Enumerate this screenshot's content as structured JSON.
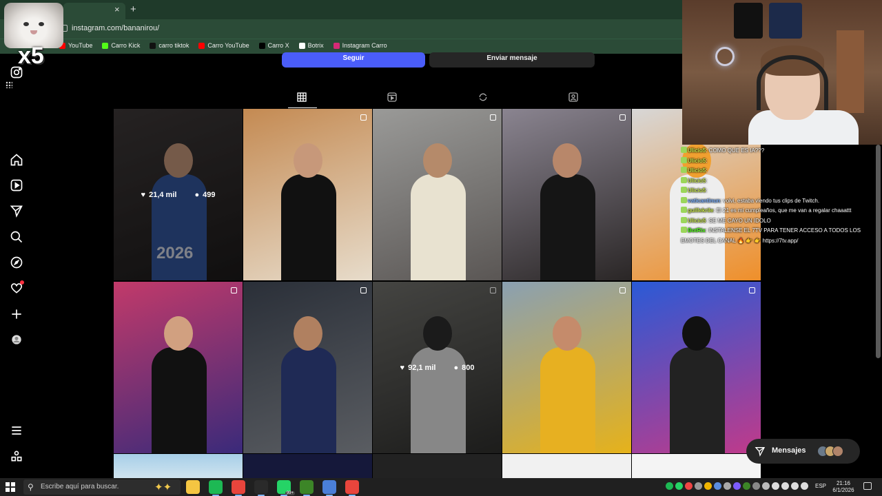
{
  "browser": {
    "url": "instagram.com/bananirou/",
    "tab_close_glyph": "×",
    "new_tab_glyph": "+",
    "bookmarks": [
      {
        "label": "YouTube",
        "color": "#ff0000"
      },
      {
        "label": "Carro Kick",
        "color": "#53fc18"
      },
      {
        "label": "carro tiktok",
        "color": "#111111"
      },
      {
        "label": "Carro YouTube",
        "color": "#ff0000"
      },
      {
        "label": "Carro X",
        "color": "#000000"
      },
      {
        "label": "Botrix",
        "color": "#ffffff"
      },
      {
        "label": "Instagram Carro",
        "color": "#d62976"
      }
    ]
  },
  "overlay": {
    "multiplier": "x5"
  },
  "profile": {
    "follow_label": "Seguir",
    "message_label": "Enviar mensaje",
    "tabs": [
      "grid-icon",
      "reels-icon",
      "reposts-icon",
      "tagged-icon"
    ],
    "active_tab": "grid-icon"
  },
  "posts": [
    {
      "likes": "21,4 mil",
      "comments": "499",
      "hover": true,
      "caption": "2026"
    },
    {
      "likes": "",
      "comments": "",
      "hover": false
    },
    {
      "likes": "",
      "comments": "",
      "hover": false
    },
    {
      "likes": "",
      "comments": "",
      "hover": false
    },
    {
      "likes": "",
      "comments": "",
      "hover": false
    },
    {
      "likes": "",
      "comments": "",
      "hover": false
    },
    {
      "likes": "",
      "comments": "",
      "hover": false
    },
    {
      "likes": "92,1 mil",
      "comments": "800",
      "hover": true
    },
    {
      "likes": "",
      "comments": "",
      "hover": false
    },
    {
      "likes": "",
      "comments": "",
      "hover": false
    }
  ],
  "chat": [
    {
      "user": "Ulicio5",
      "text": ": COMO QUE ES IA???",
      "user_color": "#c8e64b"
    },
    {
      "user": "Ulicio5",
      "text": ": ",
      "user_color": "#c8e64b"
    },
    {
      "user": "Ulicio5",
      "text": ": ",
      "user_color": "#c8e64b"
    },
    {
      "user": "Ulicio5",
      "text": ": ",
      "user_color": "#c8e64b"
    },
    {
      "user": "Ulicio5",
      "text": ": ",
      "user_color": "#c8e64b"
    },
    {
      "user": "vaticantinun",
      "text": ": volvi, estaba viendo tus clips de Twitch.",
      "user_color": "#7ab0ff"
    },
    {
      "user": "guillekrile",
      "text": ": El 21 es mi cumpleaños, que me van a regalar chaaattt",
      "user_color": "#c8e64b"
    },
    {
      "user": "Ulicio5",
      "text": ": SE ME CAYO UN IDOLO",
      "user_color": "#c8e64b"
    },
    {
      "user": "BotRix",
      "text": ": INSTALENSE EL 7TV PARA TENER ACCESO A TODOS LOS",
      "user_color": "#53fc18"
    },
    {
      "user": "",
      "text": "EMOTES DEL CANAL 🔥 👉 👉 https://7tv.app/",
      "user_color": "#ffffff"
    }
  ],
  "messages_pill": {
    "label": "Mensajes"
  },
  "taskbar": {
    "search_placeholder": "Escribe aquí para buscar.",
    "apps": [
      {
        "name": "file-explorer-icon",
        "color": "#f4c542"
      },
      {
        "name": "spotify-icon",
        "color": "#1db954"
      },
      {
        "name": "chrome-icon",
        "color": "#e8453c"
      },
      {
        "name": "obs-icon",
        "color": "#2a2a2a"
      },
      {
        "name": "whatsapp-icon",
        "color": "#25d366"
      },
      {
        "name": "minecraft-icon",
        "color": "#3c8527"
      },
      {
        "name": "calendar-app-icon",
        "color": "#4a7fd8"
      },
      {
        "name": "chrome-profile-icon",
        "color": "#e8453c"
      }
    ],
    "whatsapp_badge": "99+",
    "language": "ESP",
    "time": "21:16",
    "date": "6/1/2026"
  },
  "colors": {
    "accent": "#4a5df9",
    "notification": "#ff3040",
    "chrome_green": "#2b4b37"
  }
}
